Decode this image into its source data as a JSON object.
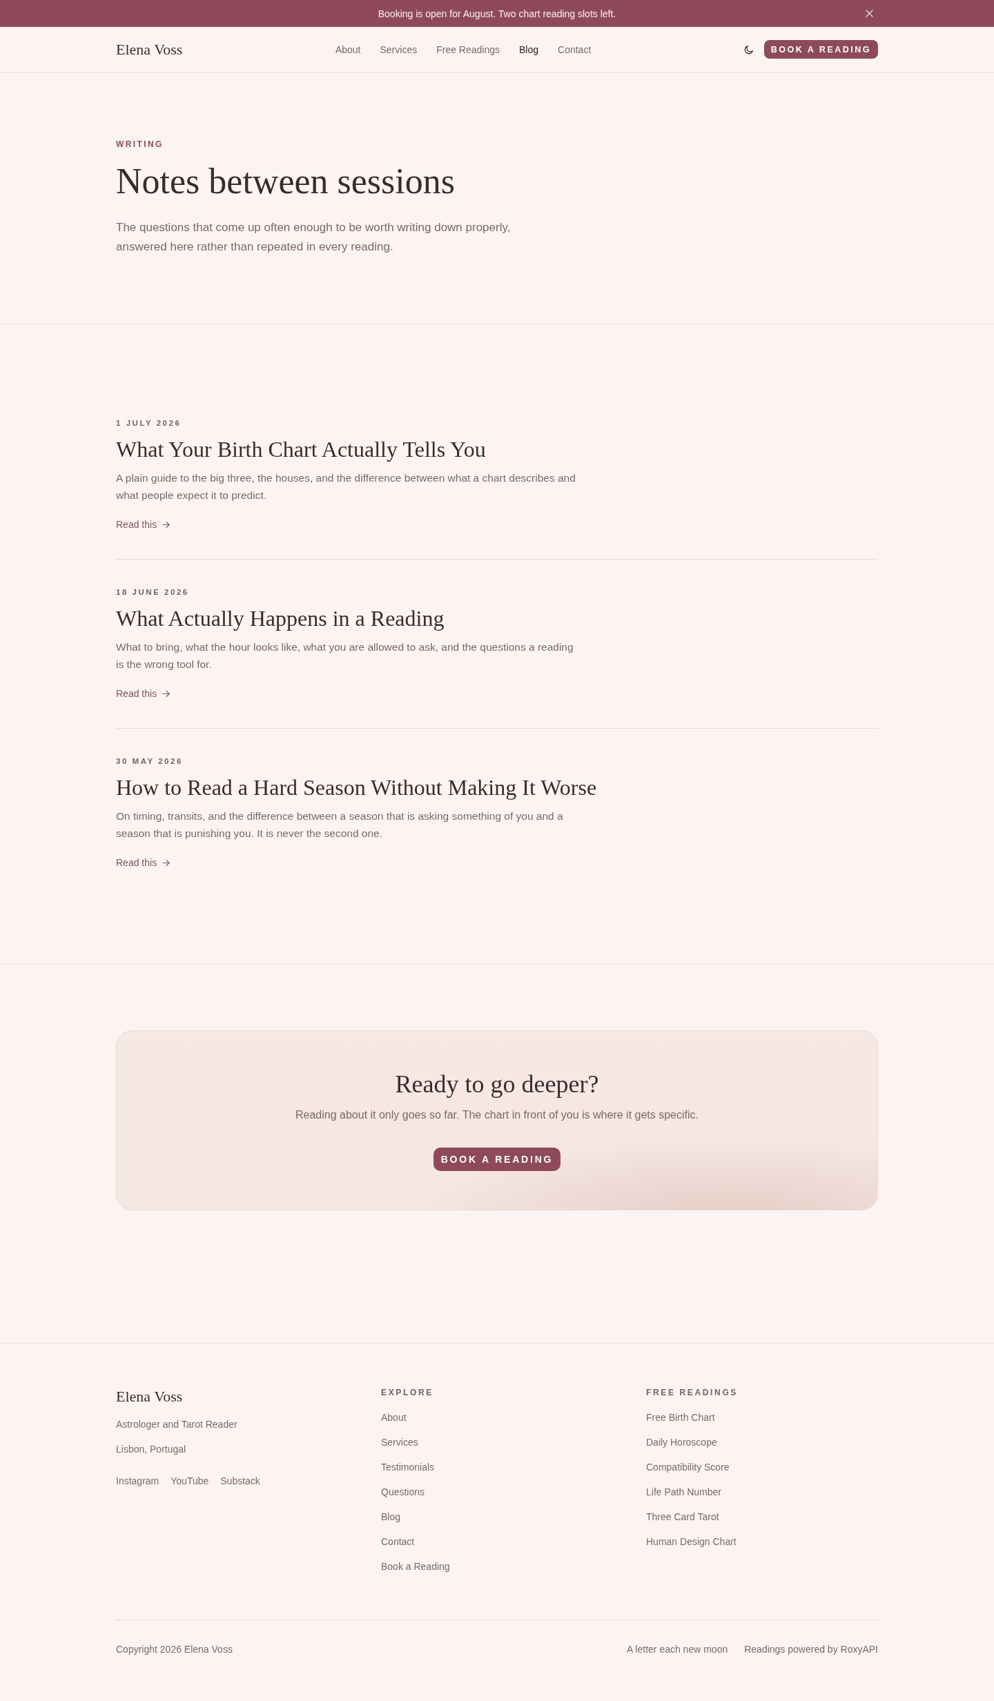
{
  "announcement": {
    "text": "Booking is open for August. Two chart reading slots left."
  },
  "header": {
    "logo": "Elena Voss",
    "nav": [
      {
        "label": "About",
        "selected": false
      },
      {
        "label": "Services",
        "selected": false
      },
      {
        "label": "Free Readings",
        "selected": false
      },
      {
        "label": "Blog",
        "selected": true
      },
      {
        "label": "Contact",
        "selected": false
      }
    ],
    "cta": "BOOK A READING"
  },
  "hero": {
    "eyebrow": "WRITING",
    "title": "Notes between sessions",
    "intro": "The questions that come up often enough to be worth writing down properly, answered here rather than repeated in every reading."
  },
  "posts": [
    {
      "date": "1 JULY 2026",
      "title": "What Your Birth Chart Actually Tells You",
      "summary": "A plain guide to the big three, the houses, and the difference between what a chart describes and what people expect it to predict.",
      "link": "Read this"
    },
    {
      "date": "18 JUNE 2026",
      "title": "What Actually Happens in a Reading",
      "summary": "What to bring, what the hour looks like, what you are allowed to ask, and the questions a reading is the wrong tool for.",
      "link": "Read this"
    },
    {
      "date": "30 MAY 2026",
      "title": "How to Read a Hard Season Without Making It Worse",
      "summary": "On timing, transits, and the difference between a season that is asking something of you and a season that is punishing you. It is never the second one.",
      "link": "Read this"
    }
  ],
  "cta": {
    "title": "Ready to go deeper?",
    "text": "Reading about it only goes so far. The chart in front of you is where it gets specific.",
    "button": "BOOK A READING"
  },
  "footer": {
    "brand": "Elena Voss",
    "tagline": "Astrologer and Tarot Reader",
    "location": "Lisbon, Portugal",
    "socials": [
      "Instagram",
      "YouTube",
      "Substack"
    ],
    "columns": [
      {
        "heading": "EXPLORE",
        "links": [
          "About",
          "Services",
          "Testimonials",
          "Questions",
          "Blog",
          "Contact",
          "Book a Reading"
        ]
      },
      {
        "heading": "FREE READINGS",
        "links": [
          "Free Birth Chart",
          "Daily Horoscope",
          "Compatibility Score",
          "Life Path Number",
          "Three Card Tarot",
          "Human Design Chart"
        ]
      }
    ],
    "copyright": "Copyright 2026 Elena Voss",
    "bottom_links": [
      "A letter each new moon",
      "Readings powered by RoxyAPI"
    ]
  }
}
